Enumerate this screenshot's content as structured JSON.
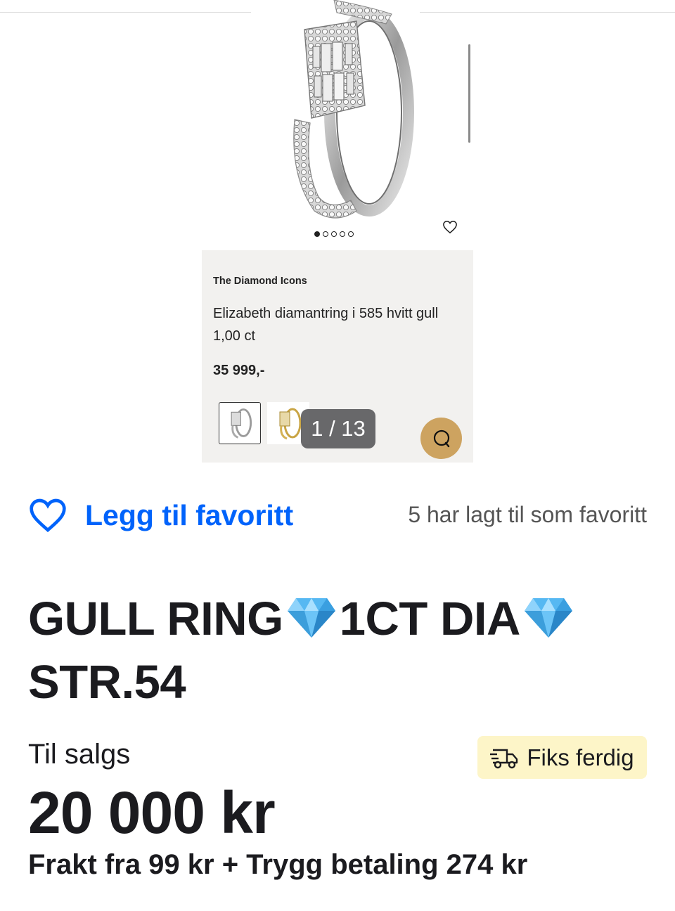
{
  "gallery": {
    "dots_count": 5,
    "active_dot": 1,
    "card": {
      "brand": "The Diamond Icons",
      "product_name": "Elizabeth diamantring i 585 hvitt gull 1,00 ct",
      "price": "35 999,-"
    },
    "counter": "1 / 13",
    "chat_icon": "chat-bubble-icon",
    "favourite_icon": "heart-outline-icon"
  },
  "favorite": {
    "label": "Legg til favoritt",
    "count_text": "5 har lagt til som favoritt",
    "icon": "heart-outline-icon",
    "color": "#0063fb"
  },
  "listing": {
    "title_part1": "GULL RING",
    "title_part2": "1CT DIA",
    "title_part3": "STR.54",
    "title_emoji": "gem-stone-icon",
    "status": "Til salgs",
    "badge_label": "Fiks ferdig",
    "badge_icon": "delivery-truck-icon",
    "badge_color": "#fdf5c8",
    "price": "20 000 kr",
    "shipping": "Frakt fra 99 kr + Trygg betaling 274 kr"
  }
}
